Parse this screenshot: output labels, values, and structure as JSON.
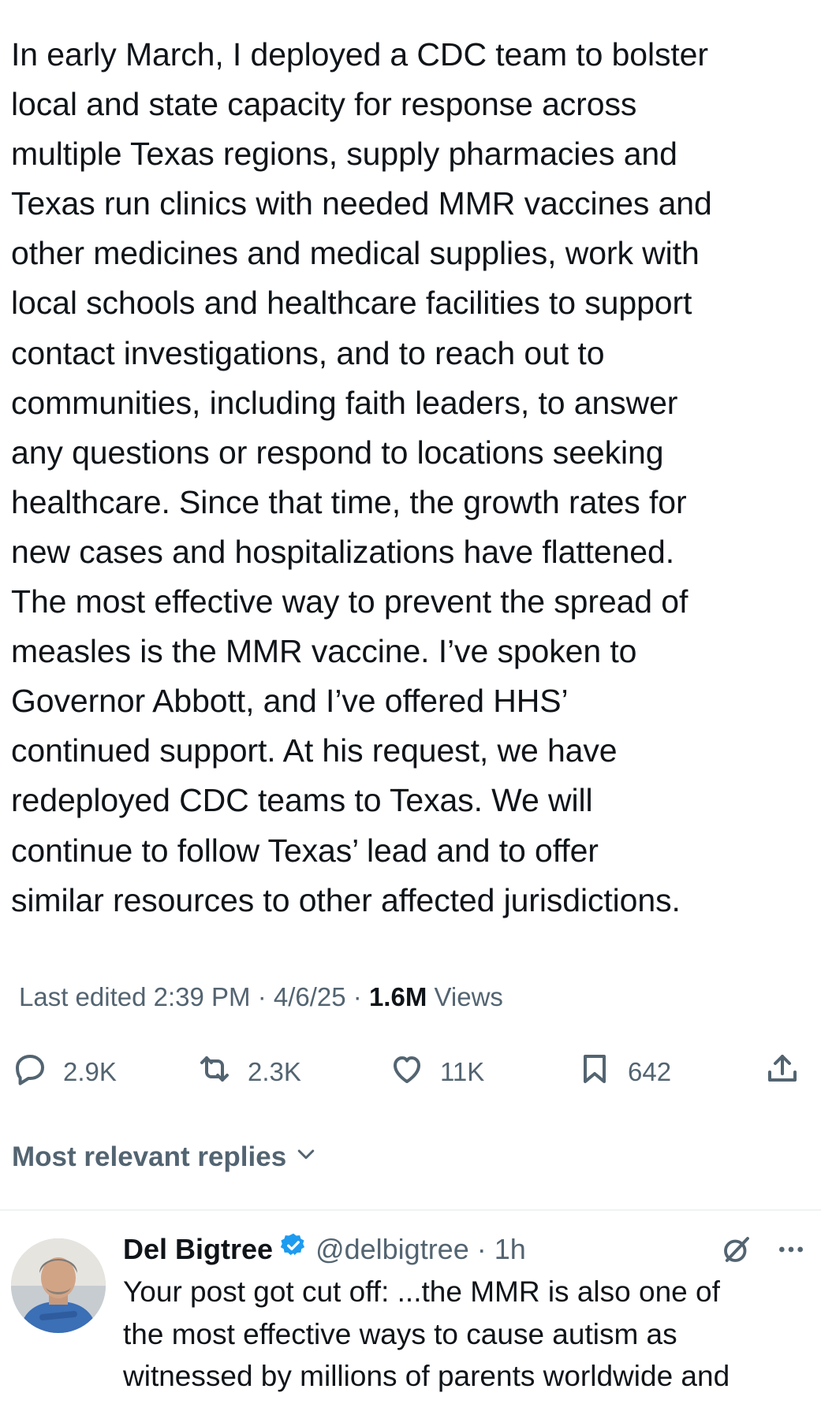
{
  "post": {
    "text": "In early March, I deployed a CDC team to bolster\nlocal and state capacity for response across\nmultiple Texas regions, supply pharmacies and\nTexas run clinics with needed MMR vaccines and\nother medicines and medical supplies, work with\nlocal schools and healthcare facilities to support\ncontact investigations, and to reach out to\ncommunities, including faith leaders, to answer\nany questions or respond to locations seeking\nhealthcare. Since that time, the growth rates for\nnew cases and hospitalizations have flattened.\nThe most effective way to prevent the spread of\nmeasles is the MMR vaccine. I’ve spoken to\nGovernor Abbott, and I’ve offered HHS’\ncontinued support. At his request, we have\nredeployed CDC teams to Texas. We will\ncontinue to follow Texas’ lead and to offer\nsimilar resources to other affected jurisdictions.",
    "meta": {
      "edited_label": "Last edited 2:39 PM · 4/6/25",
      "separator": "·",
      "views_count": "1.6M",
      "views_label": "Views"
    },
    "actions": {
      "replies": "2.9K",
      "reposts": "2.3K",
      "likes": "11K",
      "bookmarks": "642"
    }
  },
  "replies_section": {
    "title": "Most relevant replies"
  },
  "reply": {
    "name": "Del Bigtree",
    "handle": "@delbigtree · 1h",
    "text": "Your post got cut off: ...the MMR is also one of\nthe most effective ways to cause autism as\nwitnessed by millions of parents worldwide and"
  },
  "colors": {
    "text": "#0f1419",
    "muted": "#536471",
    "verified": "#1d9bf0",
    "divider": "#eff3f4"
  },
  "icons": [
    "reply-icon",
    "repost-icon",
    "like-icon",
    "bookmark-icon",
    "share-icon",
    "chevron-down-icon",
    "verified-badge-icon",
    "grok-icon",
    "more-icon"
  ]
}
